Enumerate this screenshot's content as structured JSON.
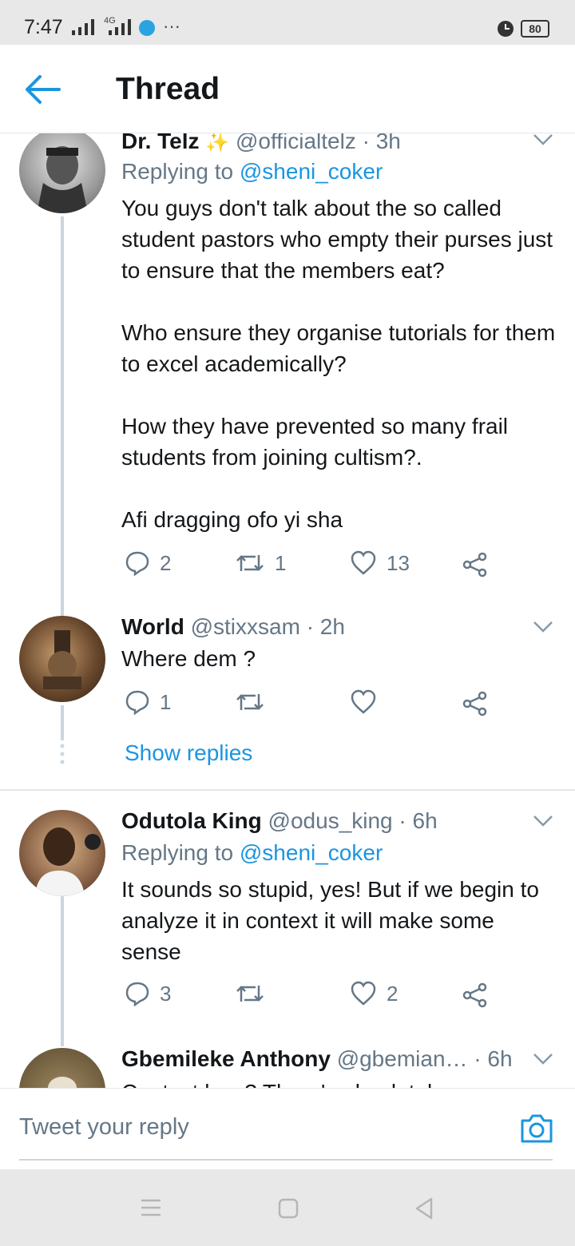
{
  "status_bar": {
    "time": "7:47",
    "network": "4G",
    "battery": "80",
    "more": "···"
  },
  "header": {
    "title": "Thread"
  },
  "tweets": [
    {
      "name": "Dr. Telz",
      "handle": "@officialtelz · 3h",
      "replying_prefix": "Replying to ",
      "replying_to": "@sheni_coker",
      "body": "You guys don't talk about the so called student pastors who empty their purses just to ensure that the members eat?\n\nWho ensure they organise tutorials for them to excel academically?\n\nHow they have prevented so many frail students from joining cultism?.\n\nAfi dragging ofo yi sha",
      "replies": "2",
      "retweets": "1",
      "likes": "13"
    },
    {
      "name": "World",
      "handle": "@stixxsam · 2h",
      "body": "Where dem ?",
      "replies": "1",
      "retweets": "",
      "likes": "",
      "show_replies": "Show replies"
    },
    {
      "name": "Odutola King",
      "handle": "@odus_king · 6h",
      "replying_prefix": "Replying to ",
      "replying_to": "@sheni_coker",
      "body": "It sounds so stupid, yes! But if we begin to analyze it in context it will make some sense",
      "replies": "3",
      "retweets": "",
      "likes": "2"
    },
    {
      "name": "Gbemileke Anthony",
      "handle": "@gbemian… · 6h",
      "body": "Context kwa? There's absolutely no"
    }
  ],
  "reply_bar": {
    "placeholder": "Tweet your reply"
  },
  "colors": {
    "accent": "#1b95e0",
    "secondary_text": "#657786",
    "thread_line": "#ccd6dd"
  },
  "icons": [
    "back-arrow-icon",
    "reply-icon",
    "retweet-icon",
    "like-icon",
    "share-icon",
    "chevron-down-icon",
    "camera-icon",
    "menu-nav-icon",
    "home-nav-icon",
    "back-nav-icon"
  ]
}
